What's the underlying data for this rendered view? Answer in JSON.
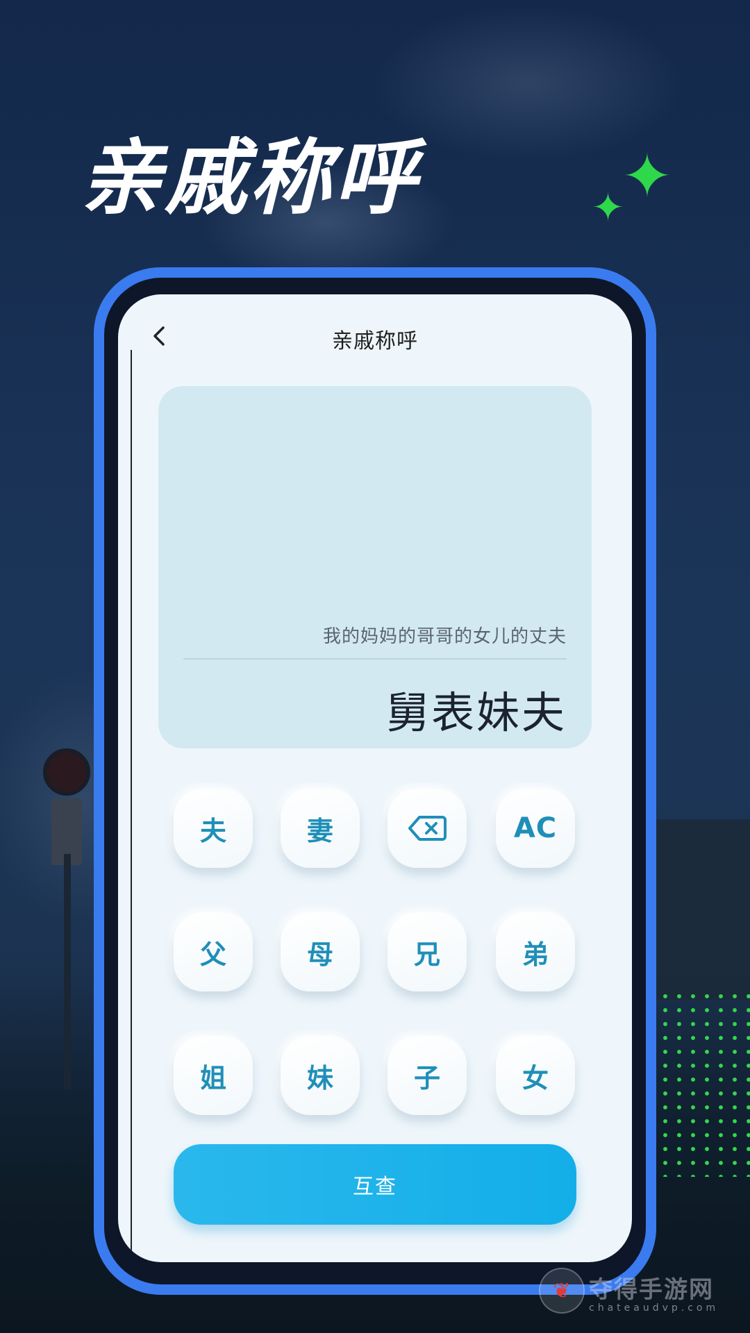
{
  "promo": {
    "headline": "亲戚称呼"
  },
  "app": {
    "nav_title": "亲戚称呼",
    "back_icon": "‹",
    "display": {
      "expression": "我的妈妈的哥哥的女儿的丈夫",
      "result": "舅表妹夫"
    },
    "keys": [
      {
        "label": "夫",
        "icon": null
      },
      {
        "label": "妻",
        "icon": null
      },
      {
        "label": "",
        "icon": "backspace-icon"
      },
      {
        "label": "AC",
        "icon": null
      },
      {
        "label": "父",
        "icon": null
      },
      {
        "label": "母",
        "icon": null
      },
      {
        "label": "兄",
        "icon": null
      },
      {
        "label": "弟",
        "icon": null
      },
      {
        "label": "姐",
        "icon": null
      },
      {
        "label": "妹",
        "icon": null
      },
      {
        "label": "子",
        "icon": null
      },
      {
        "label": "女",
        "icon": null
      }
    ],
    "query_button": "互查"
  },
  "watermark": {
    "text": "夺得手游网",
    "url": "chateaudvp.com"
  },
  "colors": {
    "frame": "#3b7bf0",
    "accent": "#1f8fb8",
    "button": "#13aee9",
    "sparkle": "#2fd84a"
  }
}
